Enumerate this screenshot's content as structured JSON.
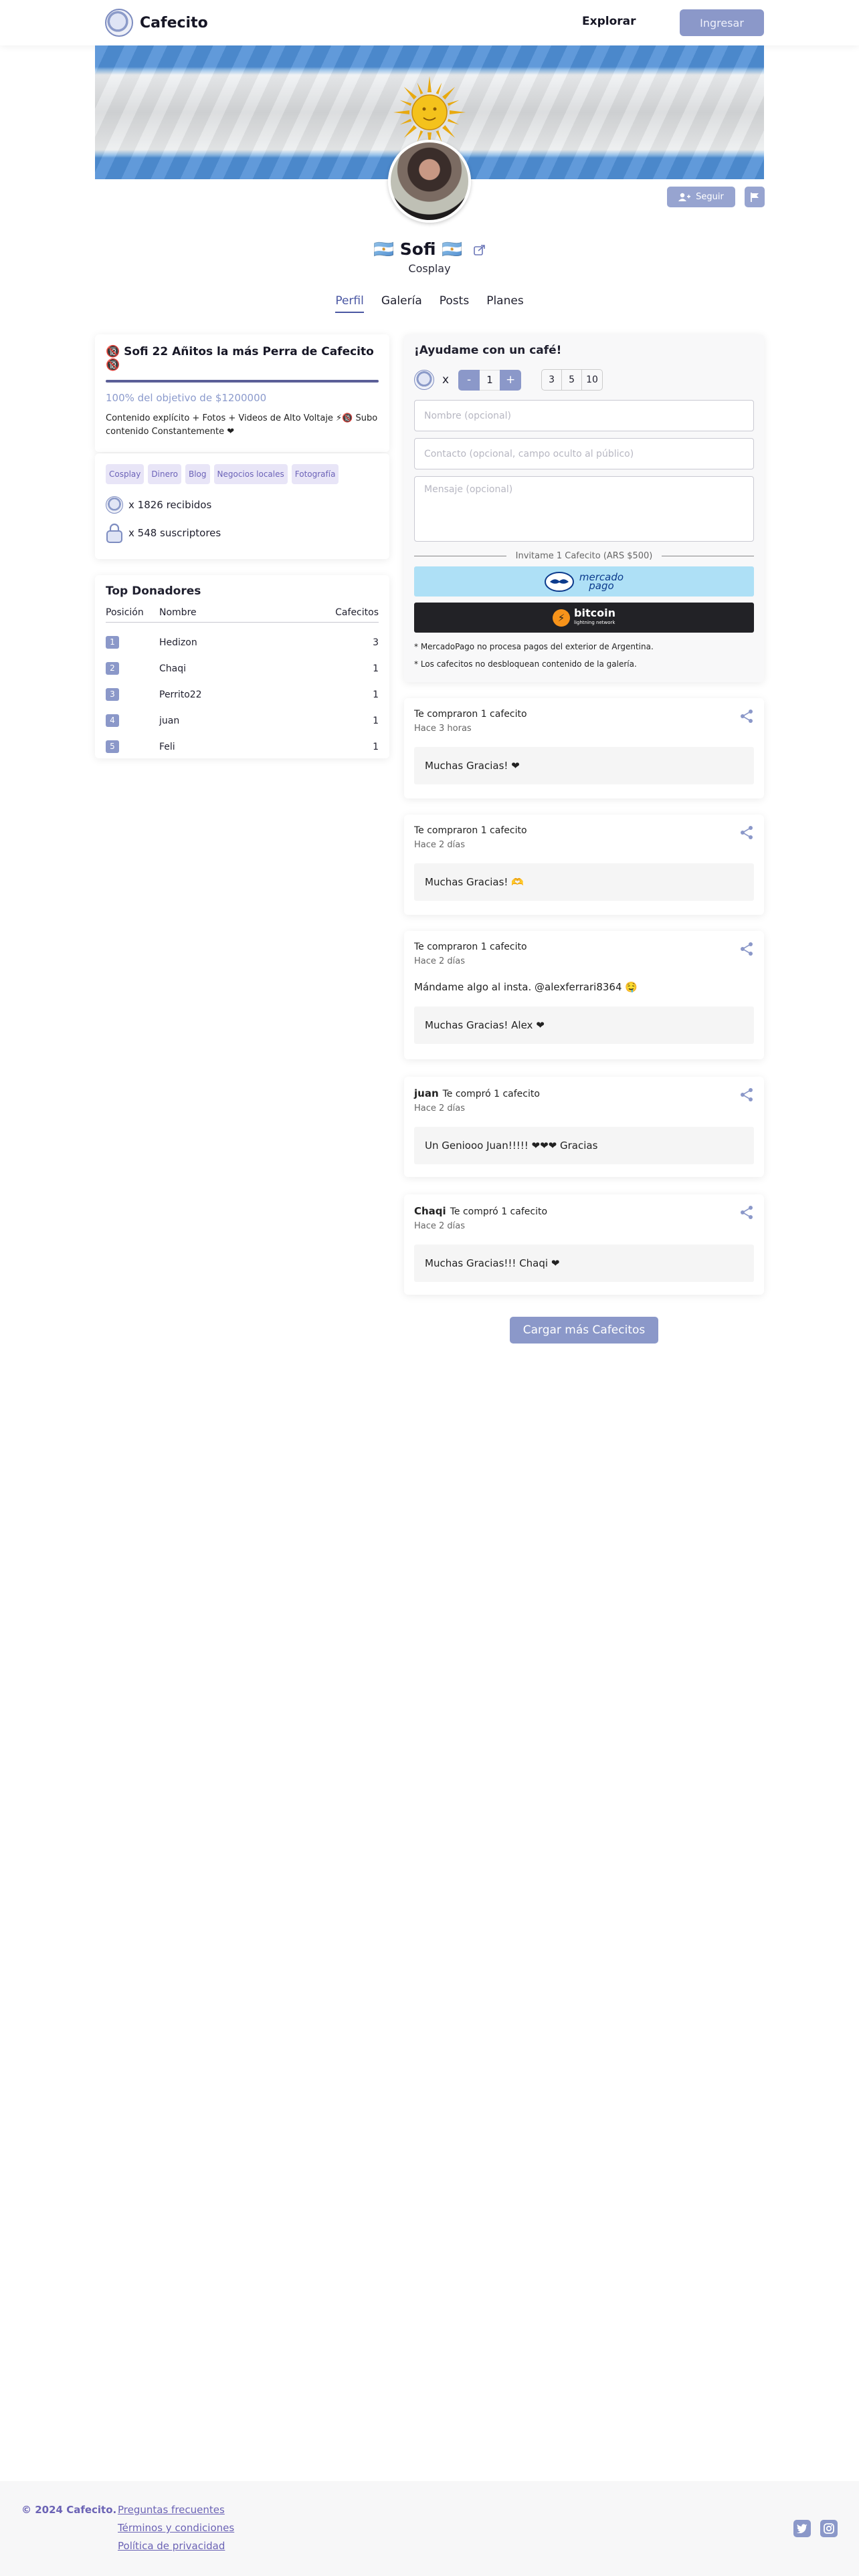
{
  "header": {
    "brand": "Cafecito",
    "explore_label": "Explorar",
    "login_label": "Ingresar"
  },
  "profile": {
    "name": "🇦🇷 Sofi 🇦🇷",
    "category": "Cosplay",
    "follow_label": "Seguir",
    "tabs": [
      "Perfil",
      "Galería",
      "Posts",
      "Planes"
    ],
    "active_tab": "Perfil"
  },
  "goal": {
    "title": "🔞 Sofi 22 Añitos la más Perra de Cafecito 🔞",
    "progress_fraction": 1.0,
    "subtitle": "100% del objetivo de $1200000",
    "description": "Contenido explícito + Fotos + Videos de Alto Voltaje ⚡🔞 Subo contenido Constantemente ❤"
  },
  "tags": [
    "Cosplay",
    "Dinero",
    "Blog",
    "Negocios locales",
    "Fotografía"
  ],
  "stats": {
    "received": "x 1826 recibidos",
    "subscribers": "x 548 suscriptores"
  },
  "donors": {
    "title": "Top Donadores",
    "columns": [
      "Posición",
      "Nombre",
      "Cafecitos"
    ],
    "rows": [
      {
        "pos": "1",
        "name": "Hedizon",
        "count": "3"
      },
      {
        "pos": "2",
        "name": "Chaqi",
        "count": "1"
      },
      {
        "pos": "3",
        "name": "Perrito22",
        "count": "1"
      },
      {
        "pos": "4",
        "name": "juan",
        "count": "1"
      },
      {
        "pos": "5",
        "name": "Feli",
        "count": "1"
      }
    ]
  },
  "support": {
    "title": "¡Ayudame con un café!",
    "multiplier": "x",
    "minus": "-",
    "plus": "+",
    "quantity": "1",
    "presets": [
      "3",
      "5",
      "10"
    ],
    "name_placeholder": "Nombre (opcional)",
    "contact_placeholder": "Contacto (opcional, campo oculto al público)",
    "message_placeholder": "Mensaje (opcional)",
    "invite_text": "Invitame 1 Cafecito (ARS $500)",
    "mp_label_1": "mercado",
    "mp_label_2": "pago",
    "btc_label": "bitcoin",
    "btc_sub": "lightning network",
    "note_1": "* MercadoPago no procesa pagos del exterior de Argentina.",
    "note_2": "* Los cafecitos no desbloquean contenido de la galería."
  },
  "feed": [
    {
      "who": "",
      "action": "Te compraron 1 cafecito",
      "when": "Hace 3 horas",
      "message": "",
      "reply": "Muchas Gracias! ❤"
    },
    {
      "who": "",
      "action": "Te compraron 1 cafecito",
      "when": "Hace 2 días",
      "message": "",
      "reply": "Muchas Gracias! 🫶"
    },
    {
      "who": "",
      "action": "Te compraron 1 cafecito",
      "when": "Hace 2 días",
      "message": "Mándame algo al insta. @alexferrari8364 🤤",
      "reply": "Muchas Gracias! Alex ❤"
    },
    {
      "who": "juan",
      "action": "Te compró 1 cafecito",
      "when": "Hace 2 días",
      "message": "",
      "reply": "Un Geniooo Juan!!!!! ❤❤❤ Gracias"
    },
    {
      "who": "Chaqi",
      "action": "Te compró 1 cafecito",
      "when": "Hace 2 días",
      "message": "",
      "reply": "Muchas Gracias!!! Chaqi ❤"
    }
  ],
  "load_more_label": "Cargar más Cafecitos",
  "footer": {
    "copyright": "© 2024 Cafecito.",
    "links": [
      "Preguntas frecuentes",
      "Términos y condiciones",
      "Política de privacidad"
    ]
  },
  "colors": {
    "accent": "#8b98c9",
    "accent_dark": "#4a57a3",
    "tag_bg": "#e8e5f7",
    "mercadopago_bg": "#aee0f6",
    "bitcoin_bg": "#222226"
  }
}
